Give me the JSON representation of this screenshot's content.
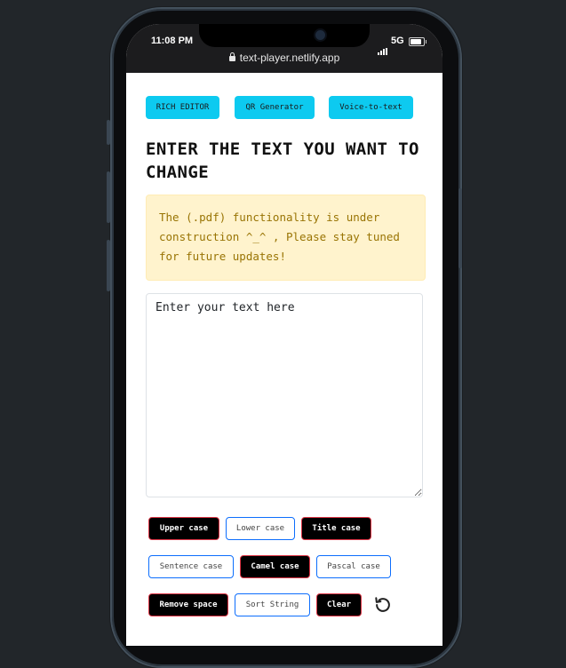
{
  "statusbar": {
    "time": "11:08 PM",
    "network": "5G",
    "battery_level": 0.85,
    "url": "text-player.netlify.app"
  },
  "nav": {
    "rich_editor": "RICH EDITOR",
    "qr_generator": "QR Generator",
    "voice_to_text": "Voice-to-text"
  },
  "main": {
    "heading": "ENTER THE TEXT YOU WANT TO CHANGE",
    "alert": "The (.pdf) functionality is under construction ^_^ , Please stay tuned for future updates!",
    "textarea_placeholder": "Enter your text here",
    "textarea_value": ""
  },
  "actions": {
    "upper_case": "Upper case",
    "lower_case": "Lower case",
    "title_case": "Title case",
    "sentence_case": "Sentence case",
    "camel_case": "Camel case",
    "pascal_case": "Pascal case",
    "remove_space": "Remove space",
    "sort_string": "Sort String",
    "clear": "Clear",
    "reset_icon": "rotate-ccw-icon"
  },
  "colors": {
    "page_background": "#22262a",
    "nav_button": "#0dcaf0",
    "alert_background": "#fff3cd",
    "alert_text": "#997404",
    "dark_button": "#000000",
    "dark_button_border": "#dc3545",
    "light_button_border": "#0d6efd"
  }
}
